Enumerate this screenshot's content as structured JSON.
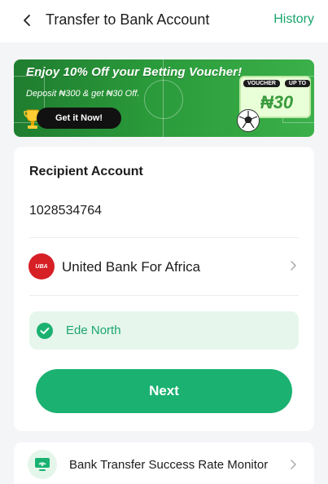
{
  "header": {
    "title": "Transfer to Bank Account",
    "history_label": "History"
  },
  "banner": {
    "headline": "Enjoy 10% Off your Betting Voucher!",
    "subtext": "Deposit ₦300 & get ₦30 Off.",
    "cta_label": "Get it Now!",
    "voucher_tag": "VOUCHER",
    "voucher_upto": "UP TO",
    "voucher_amount": "₦30"
  },
  "form": {
    "recipient_label": "Recipient Account",
    "account_number": "1028534764",
    "bank_logo_text": "UBA",
    "bank_name": "United Bank For Africa",
    "verified_name": "Ede North",
    "next_label": "Next"
  },
  "monitor": {
    "label": "Bank Transfer Success Rate Monitor"
  },
  "colors": {
    "accent": "#1ab171",
    "accent_text": "#1aa66e",
    "verify_bg": "#e6f6ec",
    "bank_logo": "#d71f26"
  },
  "icons": {
    "back": "chevron-left-icon",
    "bank_chevron": "chevron-right-icon",
    "verify": "check-circle-icon",
    "monitor": "monitor-signal-icon",
    "trophy": "trophy-icon",
    "ball": "soccer-ball-icon"
  }
}
